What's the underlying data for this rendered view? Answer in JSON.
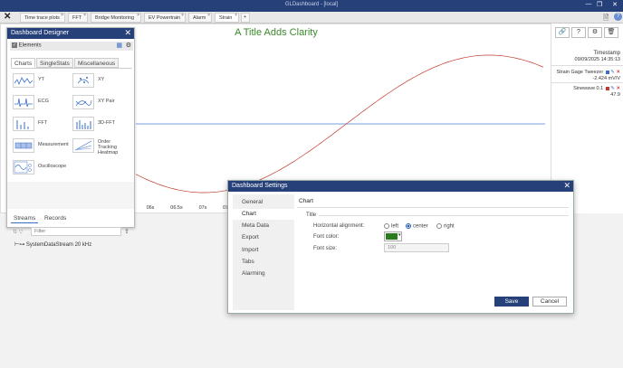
{
  "app": {
    "title": "GLDashboard - [local]"
  },
  "tabs": [
    {
      "label": "Time trace plots",
      "active": false
    },
    {
      "label": "FFT",
      "active": false
    },
    {
      "label": "Bridge Monitoring",
      "active": false
    },
    {
      "label": "EV Powertrain",
      "active": false
    },
    {
      "label": "Alarm",
      "active": false
    },
    {
      "label": "Strain",
      "active": true
    },
    {
      "label": "+",
      "active": false
    }
  ],
  "chart": {
    "title": "A Title Adds Clarity",
    "x_ticks": [
      "06s",
      "06.5s",
      "07s",
      "07"
    ],
    "line_color": "#c0392b",
    "ref_line_color": "#4a7fd4"
  },
  "right_panel": {
    "timestamp_label": "Timestamp",
    "timestamp_value": "09/09/2025 14:35:13",
    "channels": [
      {
        "name": "Strain Gage Tweezer",
        "value": "-2.424 mV/V",
        "color": "#3a6ec8"
      },
      {
        "name": "Sinewave 0.1",
        "value": "47.9",
        "color": "#c0392b"
      }
    ]
  },
  "designer": {
    "title": "Dashboard Designer",
    "elements_label": "Elements",
    "tabs": [
      "Charts",
      "SingleStats",
      "Miscellaneous"
    ],
    "charts": [
      {
        "label": "YT"
      },
      {
        "label": "XY"
      },
      {
        "label": "ECG"
      },
      {
        "label": "XY Pair"
      },
      {
        "label": "FFT"
      },
      {
        "label": "3D-FFT"
      },
      {
        "label": "Measurement"
      },
      {
        "label": "Order Tracking Heatmap"
      },
      {
        "label": "Oscilloscope"
      }
    ],
    "stream_tabs": [
      "Streams",
      "Records"
    ],
    "filter_placeholder": "Filter",
    "stream_item": "SystemDataStream 20 kHz"
  },
  "settings": {
    "title": "Dashboard Settings",
    "nav": [
      "General",
      "Chart",
      "Meta Data",
      "Export",
      "Import",
      "Tabs",
      "Alarming"
    ],
    "active_nav": "Chart",
    "section": "Chart",
    "group": "Title",
    "h_align_label": "Horizontal alignment:",
    "align_options": [
      "left",
      "center",
      "right"
    ],
    "align_selected": "center",
    "font_color_label": "Font color:",
    "font_color": "#2a7a1e",
    "font_size_label": "Font size:",
    "font_size_value": "100",
    "save_label": "Save",
    "cancel_label": "Cancel"
  }
}
